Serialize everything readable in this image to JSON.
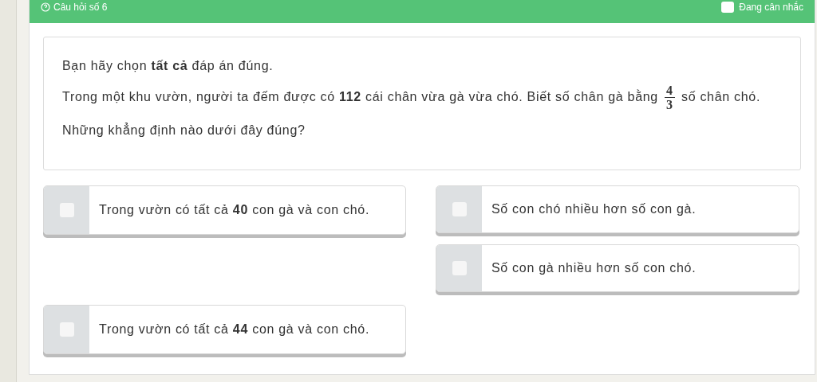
{
  "header": {
    "title": "Câu hỏi số 6",
    "flag": {
      "label": "Đang cân nhắc",
      "checked": false
    }
  },
  "question": {
    "instruction": "Bạn hãy chọn **tất cả** đáp án đúng.",
    "before": "Trong một khu vườn, người ta đếm được có **112** cái chân vừa gà vừa chó. Biết số chân gà bằng",
    "fraction": {
      "numerator": "4",
      "denominator": "3"
    },
    "after": "số chân chó. Những khẳng định nào dưới đây đúng?"
  },
  "columns": [
    [
      {
        "text": "Trong vườn có tất cả **40** con gà và con chó.",
        "checked": false
      },
      {
        "text": "Trong vườn có tất cả **44** con gà và con chó.",
        "checked": false
      }
    ],
    [
      {
        "text": "Số con chó nhiều hơn số con gà.",
        "checked": false
      },
      {
        "text": "Số con gà nhiều hơn số con chó.",
        "checked": false
      }
    ]
  ]
}
